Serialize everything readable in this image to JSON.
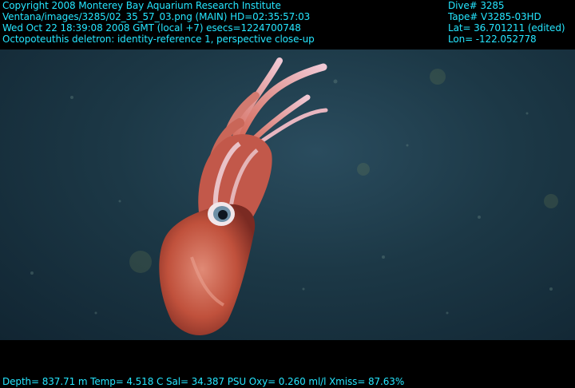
{
  "overlay": {
    "copyright": "Copyright 2008 Monterey Bay Aquarium Research Institute",
    "image_path": "Ventana/images/3285/02_35_57_03.png (MAIN)  HD=02:35:57:03",
    "datetime": "Wed Oct 22 18:39:08 2008 GMT (local +7)  esecs=1224700748",
    "annotation": "Octopoteuthis deletron: identity-reference 1, perspective close-up",
    "dive": "Dive# 3285",
    "tape": "Tape# V3285-03HD",
    "lat": "Lat= 36.701211 (edited)",
    "lon": "Lon= -122.052778",
    "sensors": "Depth= 837.71 m  Temp= 4.518 C  Sal= 34.387 PSU  Oxy= 0.260 ml/l  Xmiss= 87.63%"
  },
  "colors": {
    "overlay_text": "#25e6ff",
    "water": "#1c3846",
    "squid_body": "#c0513c"
  }
}
